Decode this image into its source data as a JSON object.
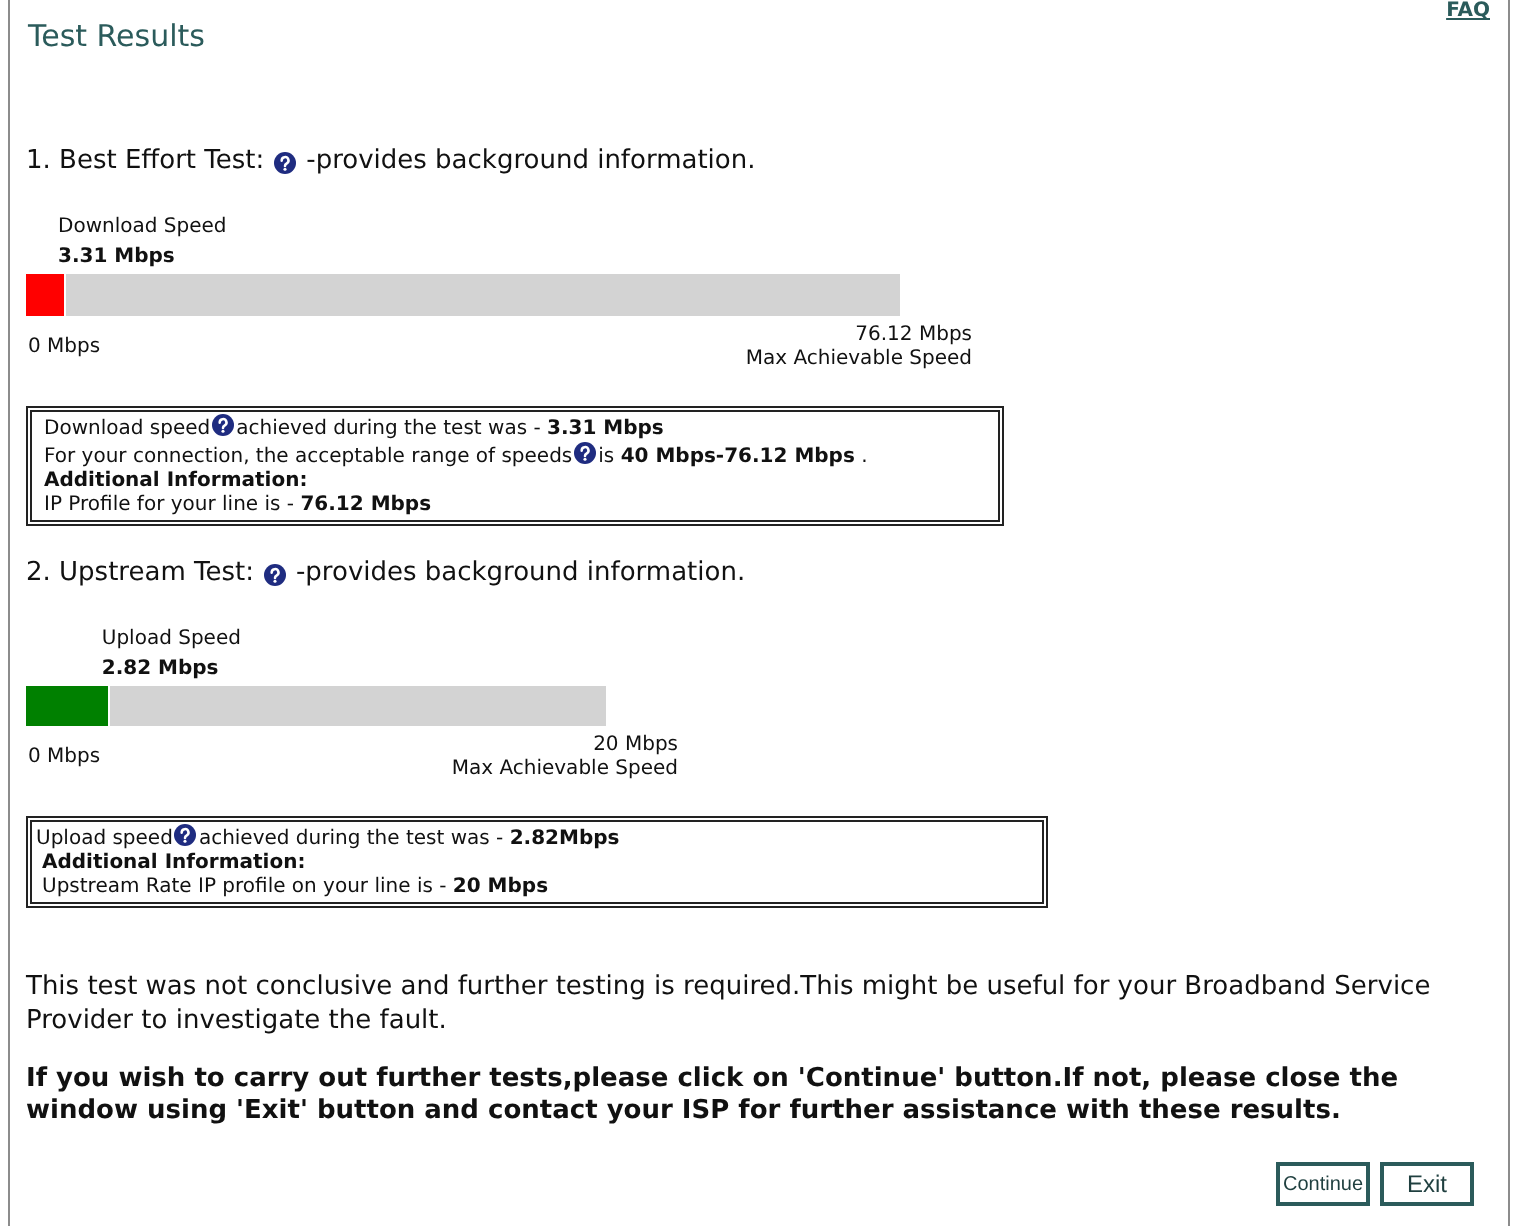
{
  "header": {
    "title": "Test Results",
    "faq_link": "FAQ"
  },
  "tests": [
    {
      "kind": "download",
      "heading": "1. Best Effort Test:",
      "heading_note": "-provides background information.",
      "meter_label": "Download Speed",
      "meter_value": "3.31 Mbps",
      "level": 0.0435,
      "color": "#ff0000",
      "min_label": "0 Mbps",
      "max_value": "76.12 Mbps",
      "max_label": "Max Achievable Speed",
      "info_lines": [
        {
          "kind": "help",
          "before": "Download speed",
          "after": "achieved during the test was - **3.31 Mbps**"
        },
        {
          "kind": "help",
          "before": "For your connection, the acceptable range of speeds",
          "after": "is **40 Mbps-76.12 Mbps** ."
        },
        {
          "kind": "heading",
          "text": "Additional Information:"
        },
        {
          "kind": "plain",
          "text": "IP Profile for your line is - **76.12 Mbps**"
        }
      ]
    },
    {
      "kind": "upload",
      "heading": "2. Upstream Test:",
      "heading_note": "-provides background information.",
      "meter_label": "Upload Speed",
      "meter_value": "2.82 Mbps",
      "level": 0.141,
      "color": "#008000",
      "min_label": "0 Mbps",
      "max_value": "20 Mbps",
      "max_label": "Max Achievable Speed",
      "info_lines": [
        {
          "kind": "help",
          "before": "Upload speed",
          "after": "achieved during the test was - **2.82Mbps**"
        },
        {
          "kind": "heading",
          "text": "Additional Information:"
        },
        {
          "kind": "plain",
          "text": "Upstream Rate IP profile on your line is - **20 Mbps**"
        }
      ]
    }
  ],
  "summary": "This test was not conclusive and further testing is required.This might be useful for your Broadband Service Provider to investigate the fault.",
  "instruction": "If you wish to carry out further tests,please click on 'Continue' button.If not, please close the window using 'Exit' button and contact your ISP for further assistance with these results.",
  "buttons": [
    "Continue",
    "Exit"
  ]
}
